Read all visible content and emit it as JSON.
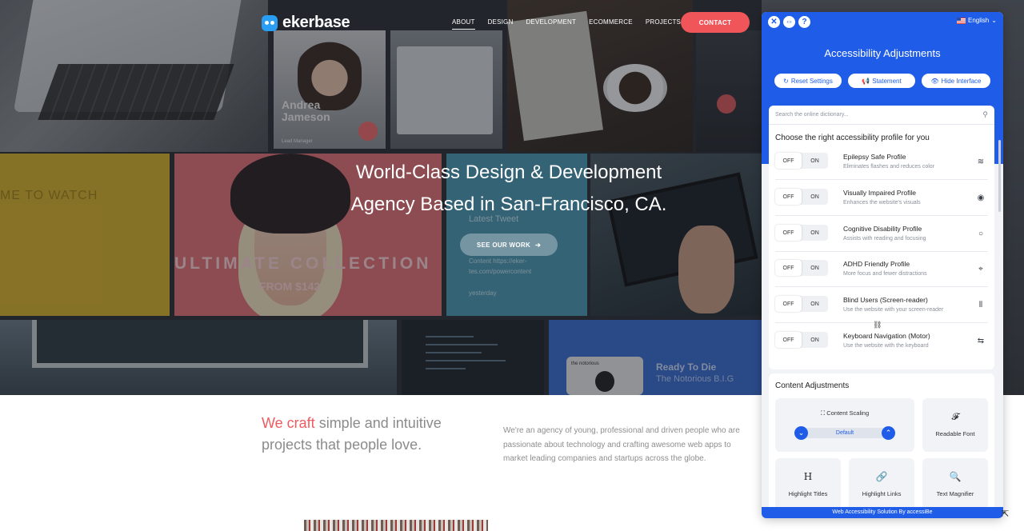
{
  "nav": {
    "logo": "ekerbase",
    "items": [
      "ABOUT",
      "DESIGN",
      "DEVELOPMENT",
      "ECOMMERCE",
      "PROJECTS"
    ],
    "contact": "CONTACT"
  },
  "hero": {
    "title_line1": "World-Class Design & Development",
    "title_line2": "Agency Based in San-Francisco, CA.",
    "cta": "SEE OUR WORK",
    "tiles": {
      "profile_name1": "Andrea",
      "profile_name2": "Jameson",
      "profile_role": "Lead Manager",
      "watch": "ME TO WATCH",
      "collection": "ULTIMATE COLLECTION",
      "from": "FROM $142",
      "latest": "Latest Tweet",
      "tweet": "Content https://eker-tes.com/powercontent",
      "yesterday": "yesterday",
      "ready": "Ready To Die",
      "notorious": "The Notorious B.I.G",
      "album": "the notorious"
    }
  },
  "about": {
    "accent": "We craft",
    "rest": " simple and intuitive projects that people love.",
    "body": "We're an agency of young, professional and driven people who are passionate about technology and crafting awesome web apps to market leading companies and startups across the globe."
  },
  "panel": {
    "language": "English",
    "title": "Accessibility Adjustments",
    "reset": "Reset Settings",
    "statement": "Statement",
    "hide": "Hide Interface",
    "search_placeholder": "Search the online dictionary...",
    "profiles_title": "Choose the right accessibility profile for you",
    "off": "OFF",
    "on": "ON",
    "profiles": [
      {
        "name": "Epilepsy Safe Profile",
        "desc": "Eliminates flashes and reduces color",
        "icon": "waves-icon"
      },
      {
        "name": "Visually Impaired Profile",
        "desc": "Enhances the website's visuals",
        "icon": "eye-icon"
      },
      {
        "name": "Cognitive Disability Profile",
        "desc": "Assists with reading and focusing",
        "icon": "circle-icon"
      },
      {
        "name": "ADHD Friendly Profile",
        "desc": "More focus and fewer distractions",
        "icon": "focus-icon"
      },
      {
        "name": "Blind Users (Screen-reader)",
        "desc": "Use the website with your screen-reader",
        "icon": "soundwave-icon"
      },
      {
        "name": "Keyboard Navigation (Motor)",
        "desc": "Use the website with the keyboard",
        "icon": "arrows-icon"
      }
    ],
    "content_title": "Content Adjustments",
    "content_scaling": "Content Scaling",
    "scaling_value": "Default",
    "readable_font": "Readable Font",
    "highlight_titles": "Highlight Titles",
    "highlight_links": "Highlight Links",
    "text_magnifier": "Text Magnifier",
    "footer": "Web Accessibility Solution By accessiBe",
    "accent_color": "#1f5de9"
  }
}
